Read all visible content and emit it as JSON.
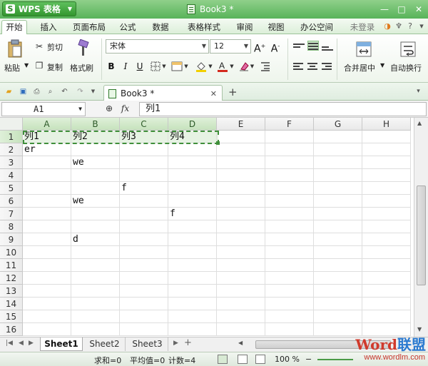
{
  "app": {
    "name": "WPS 表格",
    "logo_glyph": "S",
    "doc_title": "Book3 *"
  },
  "window_controls": {
    "minimize": "—",
    "maximize": "□",
    "close": "✕"
  },
  "menu": {
    "tabs": [
      "开始",
      "插入",
      "页面布局",
      "公式",
      "数据",
      "表格样式",
      "审阅",
      "视图",
      "办公空间"
    ],
    "login": "未登录"
  },
  "ribbon": {
    "paste": "粘贴",
    "cut": "剪切",
    "copy": "复制",
    "format_painter": "格式刷",
    "font_name": "宋体",
    "font_size": "12",
    "bold": "B",
    "italic": "I",
    "underline": "U",
    "merge_center": "合并居中",
    "auto_wrap": "自动换行"
  },
  "doc_tab": {
    "title": "Book3 *"
  },
  "formula_bar": {
    "cell_ref": "A1",
    "fx": "fx",
    "content": "列1"
  },
  "grid": {
    "columns": [
      "A",
      "B",
      "C",
      "D",
      "E",
      "F",
      "G",
      "H"
    ],
    "rows": [
      "1",
      "2",
      "3",
      "4",
      "5",
      "6",
      "7",
      "8",
      "9",
      "10",
      "11",
      "12",
      "13",
      "14",
      "15",
      "16"
    ],
    "cells": {
      "A1": "列1",
      "B1": "列2",
      "C1": "列3",
      "D1": "列4",
      "A2": "er",
      "B3": "we",
      "C5": "f",
      "B6": "we",
      "D7": "f",
      "B9": "d"
    }
  },
  "sheets": [
    "Sheet1",
    "Sheet2",
    "Sheet3"
  ],
  "status": {
    "sum": "求和=0",
    "average": "平均值=0",
    "count": "计数=4",
    "zoom": "100 %"
  },
  "watermark": {
    "logo_a": "Word",
    "logo_b": "联盟",
    "url": "www.wordlm.com"
  },
  "colors": {
    "accent": "#58b35a",
    "selection_border": "#3f8f3a",
    "header_selected": "#c6e2bd"
  }
}
